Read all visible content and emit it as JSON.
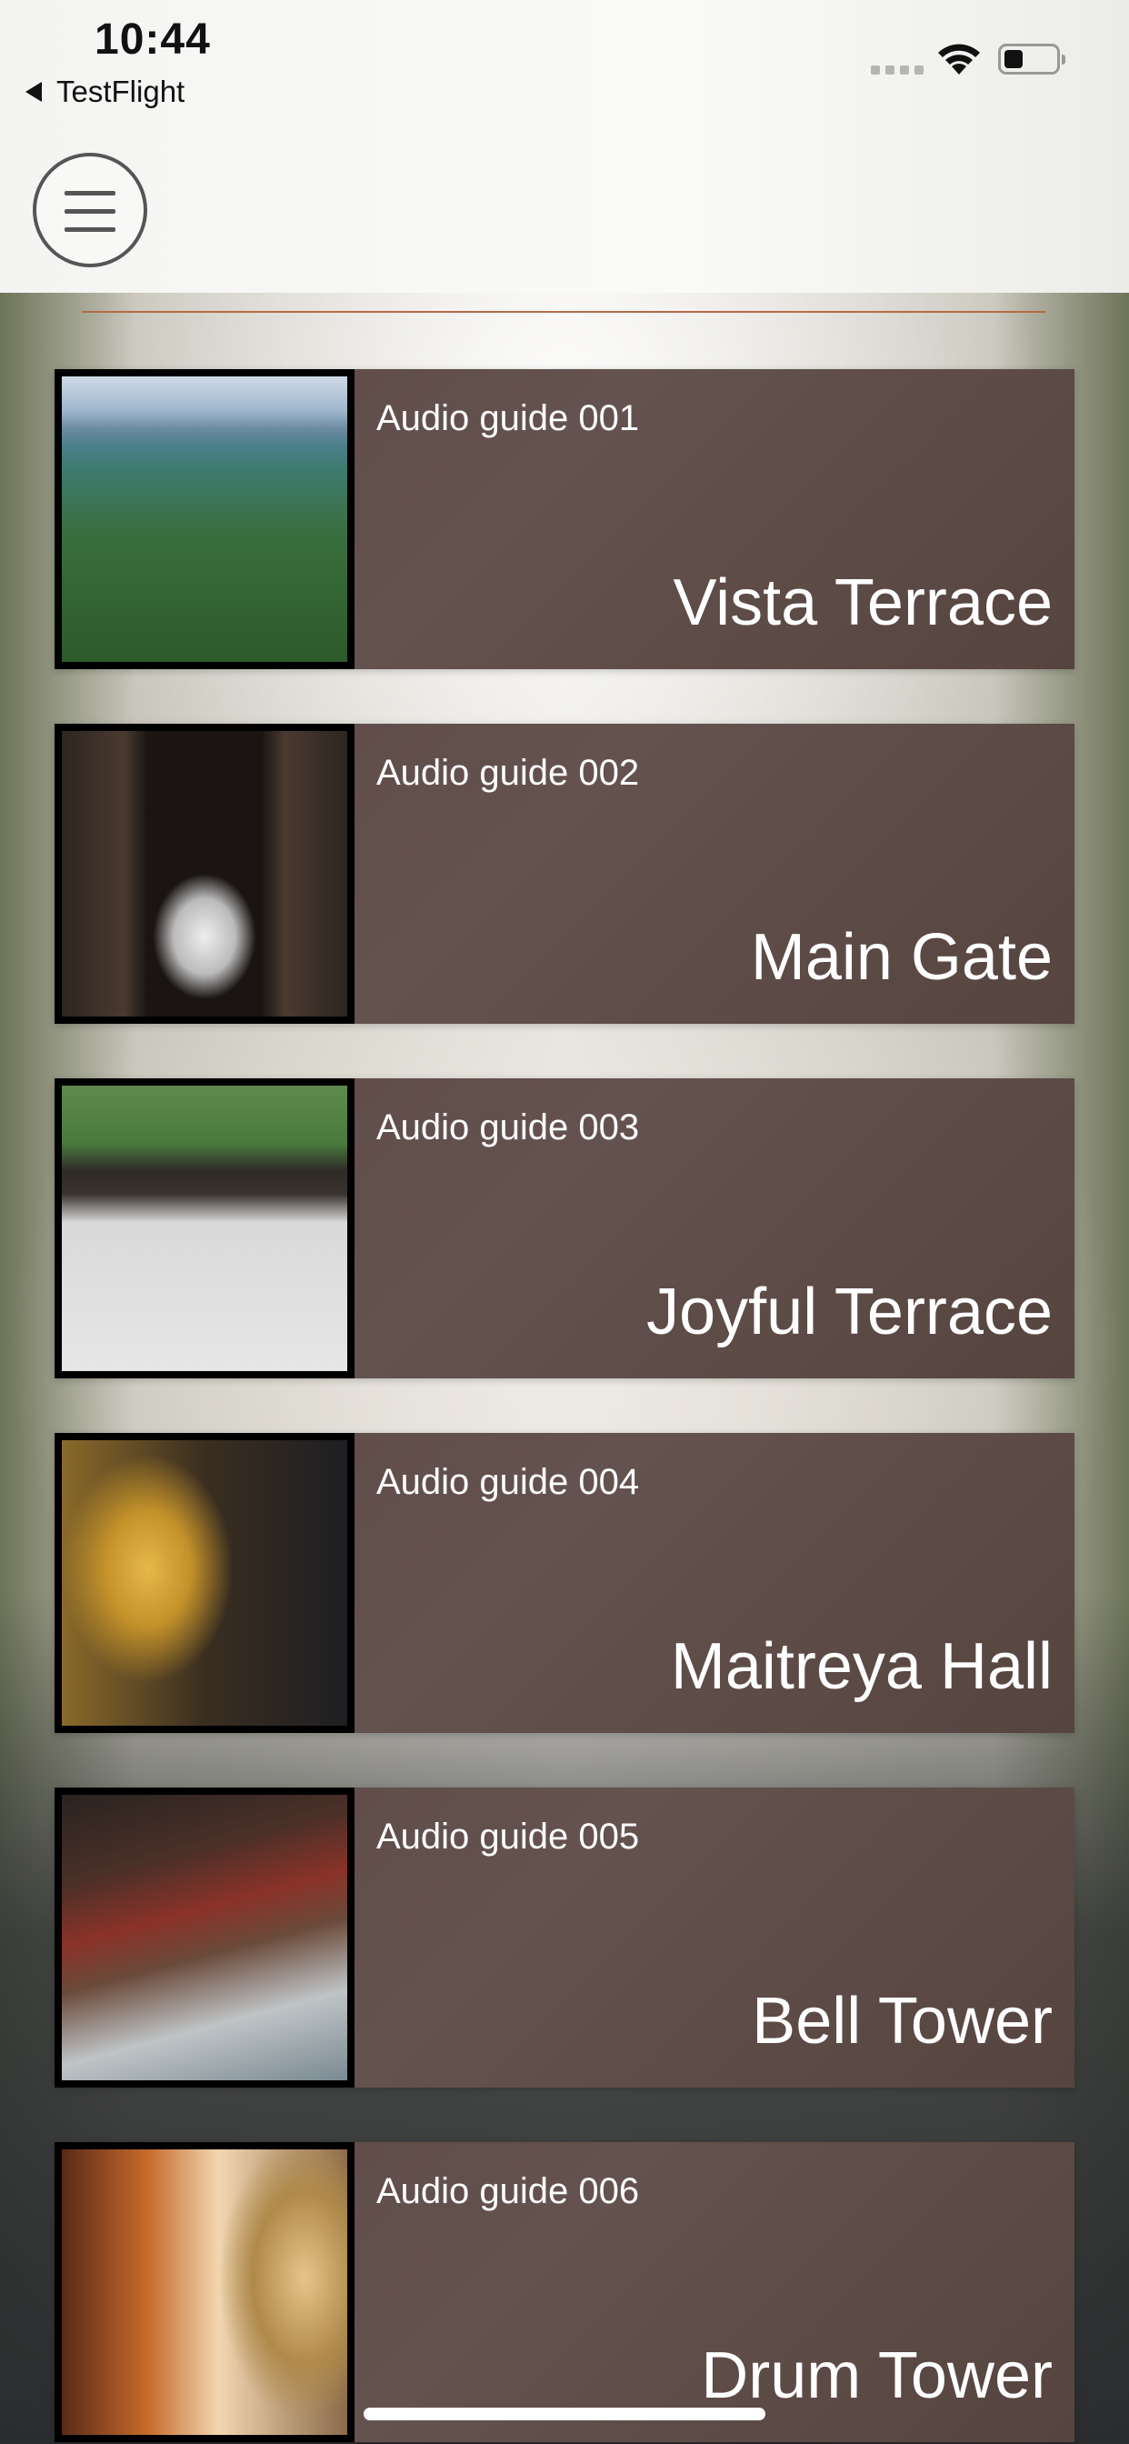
{
  "status_bar": {
    "time": "10:44",
    "back_label": "TestFlight"
  },
  "header": {
    "menu_icon": "hamburger-menu-icon"
  },
  "colors": {
    "card_background": "#5d4a46",
    "divider": "#b56a47",
    "text_on_card": "#ffffff"
  },
  "guides": [
    {
      "label": "Audio guide 001",
      "title": "Vista Terrace",
      "image": "aerial-landscape-photo"
    },
    {
      "label": "Audio guide 002",
      "title": "Main Gate",
      "image": "temple-gate-photo"
    },
    {
      "label": "Audio guide 003",
      "title": "Joyful Terrace",
      "image": "temple-courtyard-photo"
    },
    {
      "label": "Audio guide 004",
      "title": "Maitreya Hall",
      "image": "golden-buddha-photo"
    },
    {
      "label": "Audio guide 005",
      "title": "Bell Tower",
      "image": "bell-tower-photo"
    },
    {
      "label": "Audio guide 006",
      "title": "Drum Tower",
      "image": "drum-tower-photo"
    }
  ]
}
